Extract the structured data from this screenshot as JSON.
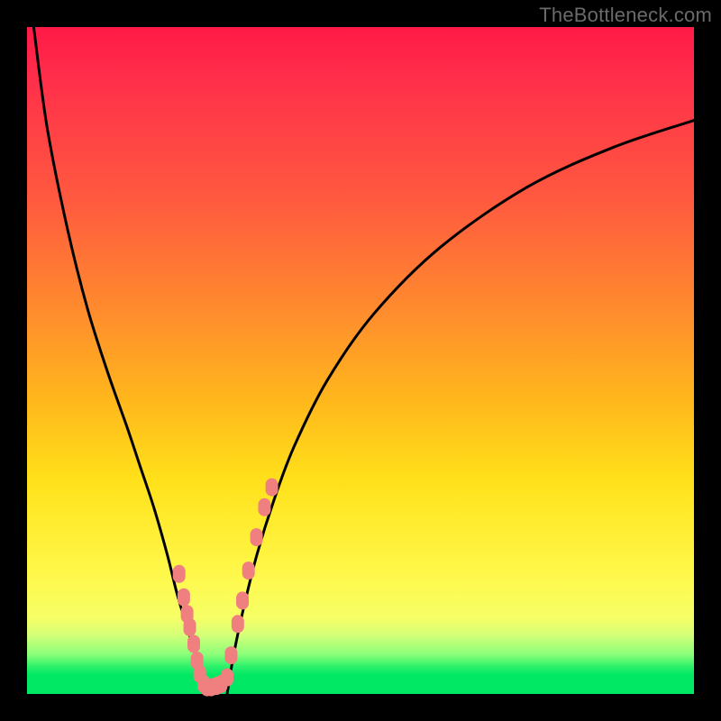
{
  "watermark": "TheBottleneck.com",
  "colors": {
    "background": "#000000",
    "curve": "#000000",
    "dots": "#f08080",
    "gradient_top": "#ff1a46",
    "gradient_orange": "#ff8a2e",
    "gradient_yellow": "#fff84a",
    "gradient_green": "#00e864"
  },
  "chart_data": {
    "type": "line",
    "title": "",
    "xlabel": "",
    "ylabel": "",
    "xlim": [
      0,
      100
    ],
    "ylim": [
      0,
      100
    ],
    "grid": false,
    "series": [
      {
        "name": "left-branch",
        "x": [
          1,
          3,
          6,
          9,
          12,
          15,
          17,
          19,
          21,
          22.5,
          24,
          25.5,
          26.5
        ],
        "values": [
          100,
          85,
          70,
          58,
          48.5,
          40,
          34,
          28,
          21,
          15,
          10,
          5,
          0
        ]
      },
      {
        "name": "right-branch",
        "x": [
          30,
          31,
          32.5,
          34.5,
          37,
          40,
          45,
          52,
          62,
          75,
          88,
          100
        ],
        "values": [
          0,
          6,
          13,
          21,
          29,
          37,
          47,
          57,
          67,
          76,
          82,
          86
        ]
      }
    ],
    "scatter_dots": {
      "name": "marker-cluster",
      "x": [
        22.8,
        23.5,
        24.0,
        24.4,
        25.0,
        25.5,
        25.9,
        26.5,
        27.0,
        27.6,
        28.4,
        29.1,
        30.0,
        30.6,
        31.6,
        32.3,
        33.2,
        34.4,
        35.6,
        36.7
      ],
      "values": [
        18.0,
        14.5,
        12.0,
        10.0,
        7.5,
        5.0,
        3.0,
        1.5,
        1.0,
        1.0,
        1.2,
        1.5,
        2.5,
        5.8,
        10.5,
        14.0,
        18.5,
        23.5,
        28.0,
        31.0
      ]
    }
  }
}
